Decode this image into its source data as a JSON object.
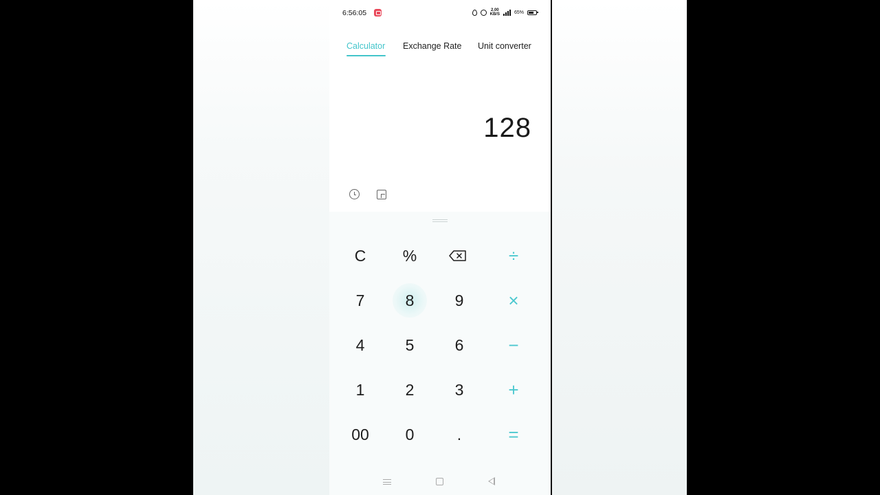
{
  "status_bar": {
    "time": "6:56:05",
    "speed_value": "2.00",
    "speed_unit": "KB/S",
    "battery": "65%"
  },
  "tabs": [
    {
      "label": "Calculator",
      "active": true
    },
    {
      "label": "Exchange Rate",
      "active": false
    },
    {
      "label": "Unit converter",
      "active": false
    }
  ],
  "display": {
    "value": "128"
  },
  "tools": {
    "history_icon": "clock-icon",
    "scientific_icon": "scientific-mode-icon"
  },
  "keys": {
    "clear": "C",
    "percent": "%",
    "divide": "÷",
    "seven": "7",
    "eight": "8",
    "nine": "9",
    "multiply": "×",
    "four": "4",
    "five": "5",
    "six": "6",
    "minus": "−",
    "one": "1",
    "two": "2",
    "three": "3",
    "plus": "+",
    "double_zero": "00",
    "zero": "0",
    "decimal": ".",
    "equals": "="
  },
  "colors": {
    "accent": "#43c5cb",
    "text": "#1d1d1d"
  }
}
